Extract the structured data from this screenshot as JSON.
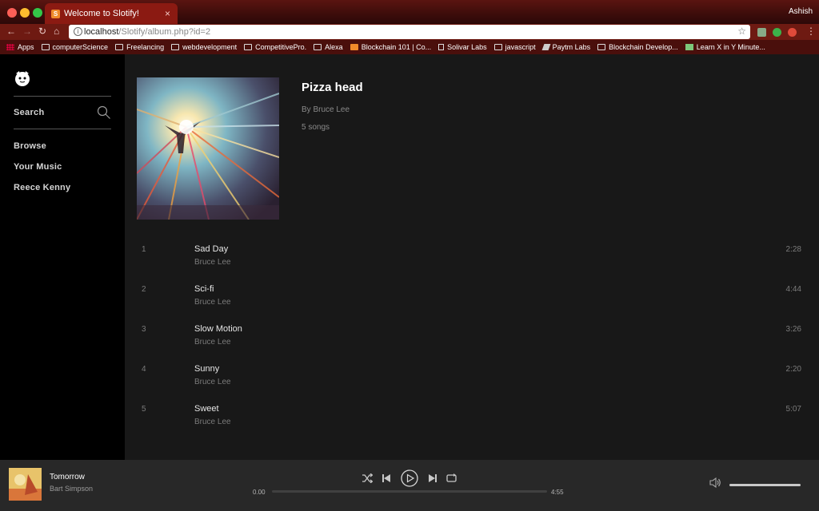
{
  "browser": {
    "tab_title": "Welcome to Slotify!",
    "tab_close": "×",
    "profile_name": "Ashish",
    "url_host": "localhost",
    "url_path": "/Slotify/album.php?id=2",
    "bookmarks": [
      {
        "label": "Apps",
        "icon": "apps-icon"
      },
      {
        "label": "computerScience",
        "icon": "folder-icon"
      },
      {
        "label": "Freelancing",
        "icon": "folder-icon"
      },
      {
        "label": "webdevelopment",
        "icon": "folder-icon"
      },
      {
        "label": "CompetitivePro.",
        "icon": "folder-icon"
      },
      {
        "label": "Alexa",
        "icon": "folder-icon"
      },
      {
        "label": "Blockchain 101 | Co...",
        "icon": "site-icon"
      },
      {
        "label": "Solivar Labs",
        "icon": "page-icon"
      },
      {
        "label": "javascript",
        "icon": "folder-icon"
      },
      {
        "label": "Paytm Labs",
        "icon": "pen-icon"
      },
      {
        "label": "Blockchain Develop...",
        "icon": "folder-icon"
      },
      {
        "label": "Learn X in Y Minute...",
        "icon": "x-icon"
      }
    ]
  },
  "sidebar": {
    "search_label": "Search",
    "items": [
      {
        "label": "Browse"
      },
      {
        "label": "Your Music"
      },
      {
        "label": "Reece Kenny"
      }
    ]
  },
  "album": {
    "title": "Pizza head",
    "artist": "By Bruce Lee",
    "song_count": "5 songs"
  },
  "tracks": [
    {
      "num": "1",
      "name": "Sad Day",
      "artist": "Bruce Lee",
      "duration": "2:28"
    },
    {
      "num": "2",
      "name": "Sci-fi",
      "artist": "Bruce Lee",
      "duration": "4:44"
    },
    {
      "num": "3",
      "name": "Slow Motion",
      "artist": "Bruce Lee",
      "duration": "3:26"
    },
    {
      "num": "4",
      "name": "Sunny",
      "artist": "Bruce Lee",
      "duration": "2:20"
    },
    {
      "num": "5",
      "name": "Sweet",
      "artist": "Bruce Lee",
      "duration": "5:07"
    }
  ],
  "player": {
    "track_title": "Tomorrow",
    "track_artist": "Bart Simpson",
    "current_time": "0.00",
    "total_time": "4:55",
    "progress_fraction": 0,
    "volume_fraction": 1.0
  },
  "colors": {
    "sidebar_bg": "#000000",
    "main_bg": "#181818",
    "player_bg": "#282828",
    "chrome_accent": "#8b1a12"
  }
}
